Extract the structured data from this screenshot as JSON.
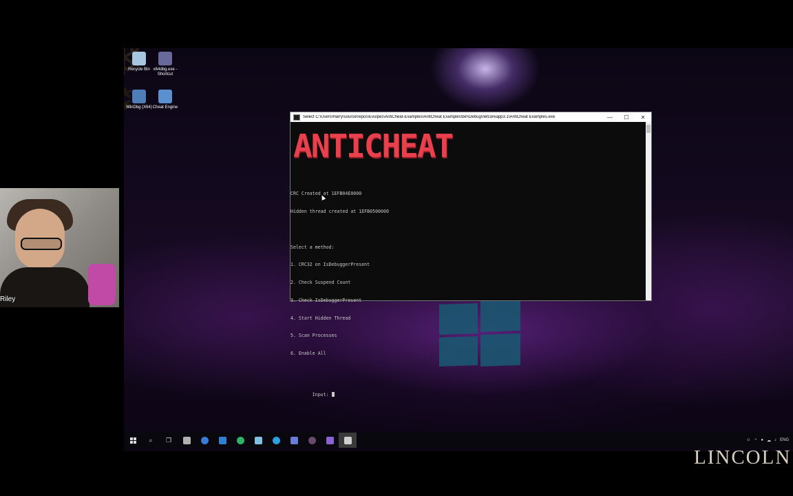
{
  "desktop": {
    "icons": [
      {
        "label": "Recycle Bin",
        "color": "#a7c7e0"
      },
      {
        "label": "x64dbg.exe - Shortcut",
        "color": "#6a6a9a"
      },
      {
        "label": "WinDbg (X64)",
        "color": "#4f7db8"
      },
      {
        "label": "Cheat Engine",
        "color": "#5a8fd0"
      }
    ]
  },
  "webcam": {
    "name_label": "Riley"
  },
  "console": {
    "title": "Select C:\\Users\\Harry\\source\\repos\\Evulpes\\AntiCheat-Examples\\AntiCheat Examples\\bin\\Debug\\netcoreapp3.1\\AntiCheat Examples.exe",
    "banner": "ANTICHEAT",
    "lines": [
      "CRC Created at 1EFB04E0000",
      "Hidden thread created at 1EFB0500000",
      "",
      "Select a method:",
      "1. CRC32 on IsDebuggerPresent",
      "2. Check Suspend Count",
      "3. Check IsDebuggerPresent",
      "4. Start Hidden Thread",
      "5. Scan Processes",
      "6. Enable All",
      ""
    ],
    "input_prompt": "Input: ",
    "controls": {
      "minimize": "—",
      "maximize": "☐",
      "close": "✕"
    }
  },
  "taskbar": {
    "start_icon": "windows-start-icon",
    "items": [
      {
        "name": "search-icon",
        "color": "#dddddd"
      },
      {
        "name": "task-view-icon",
        "color": "#dddddd"
      },
      {
        "name": "explorer-icon",
        "color": "#b0b0b0"
      },
      {
        "name": "firefox-icon",
        "color": "#3a7bd5"
      },
      {
        "name": "store-icon",
        "color": "#2f80d1"
      },
      {
        "name": "edge-icon",
        "color": "#2fb36a"
      },
      {
        "name": "notepad-icon",
        "color": "#7fbfe0"
      },
      {
        "name": "app-icon",
        "color": "#2aa0e0"
      },
      {
        "name": "discord-icon",
        "color": "#6a7bd8"
      },
      {
        "name": "spider-icon",
        "color": "#6a4a6a"
      },
      {
        "name": "visual-studio-icon",
        "color": "#8a63d2"
      },
      {
        "name": "console-icon",
        "color": "#cfcfcf"
      }
    ],
    "tray": {
      "language": "ENG"
    }
  },
  "watermark": "LINCOLN"
}
